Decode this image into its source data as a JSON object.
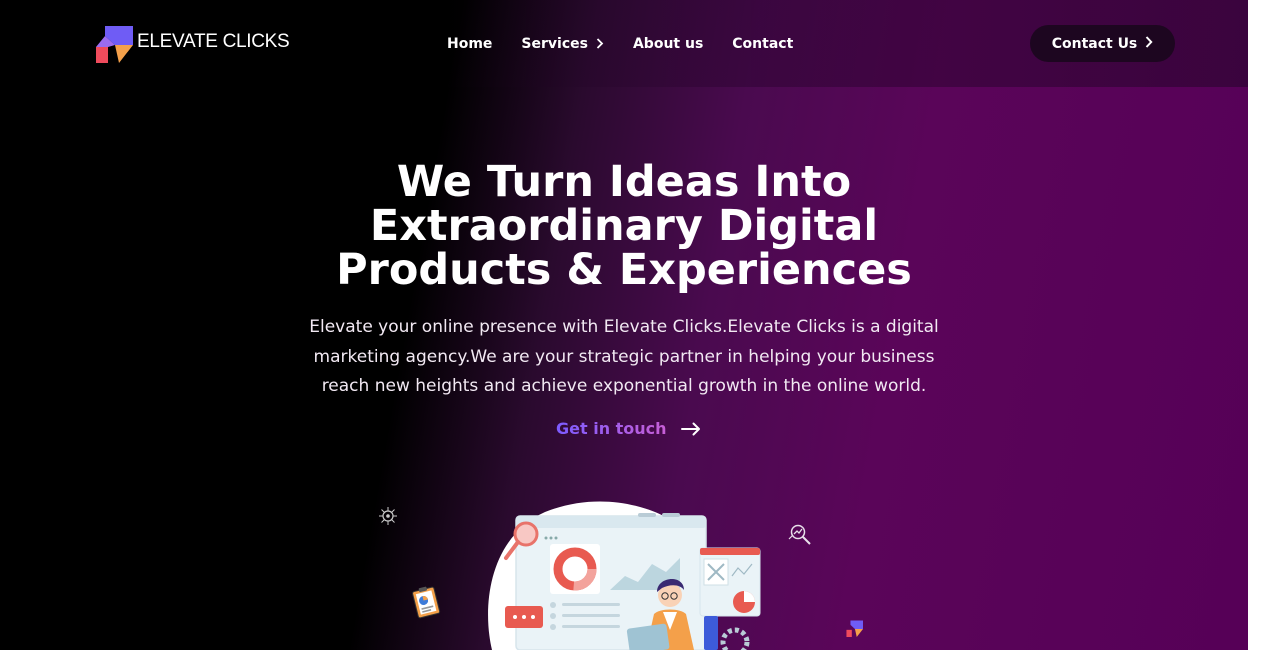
{
  "brand": {
    "name": "ELEVATE CLICKS",
    "colors": {
      "purple": "#6f5cf5",
      "orange": "#f4a04a",
      "red": "#ef4b5c"
    }
  },
  "nav": {
    "items": [
      {
        "label": "Home"
      },
      {
        "label": "Services",
        "has_dropdown": true
      },
      {
        "label": "About us"
      },
      {
        "label": "Contact"
      }
    ]
  },
  "header_cta": {
    "label": "Contact Us"
  },
  "hero": {
    "title_lines": [
      "We Turn Ideas Into",
      "Extraordinary Digital",
      "Products & Experiences"
    ],
    "description": "Elevate your online presence with Elevate Clicks.Elevate Clicks is a digital marketing agency.We are your strategic partner in helping your business reach new heights and achieve exponential growth in the online world.",
    "link_label": "Get in touch"
  },
  "theme": {
    "background_dark": "#000000",
    "background_purple": "#560057",
    "button_dark": "#1d0620"
  }
}
